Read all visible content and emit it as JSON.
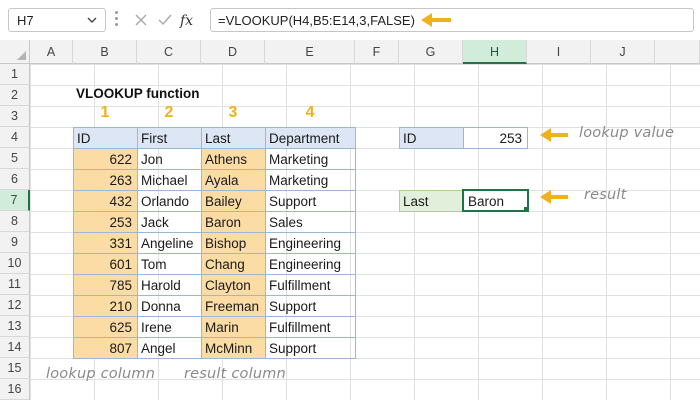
{
  "formula_bar": {
    "name_box": "H7",
    "formula": "=VLOOKUP(H4,B5:E14,3,FALSE)",
    "fx_label": "fx"
  },
  "columns": [
    "A",
    "B",
    "C",
    "D",
    "E",
    "F",
    "G",
    "H",
    "I",
    "J"
  ],
  "rows": [
    "1",
    "2",
    "3",
    "4",
    "5",
    "6",
    "7",
    "8",
    "9",
    "10",
    "11",
    "12",
    "13",
    "14",
    "15",
    "16"
  ],
  "sheet": {
    "title": "VLOOKUP function",
    "col_numbers": [
      "1",
      "2",
      "3",
      "4"
    ],
    "table_headers": [
      "ID",
      "First",
      "Last",
      "Department"
    ],
    "table_rows": [
      {
        "id": "622",
        "first": "Jon",
        "last": "Athens",
        "dept": "Marketing"
      },
      {
        "id": "263",
        "first": "Michael",
        "last": "Ayala",
        "dept": "Marketing"
      },
      {
        "id": "432",
        "first": "Orlando",
        "last": "Bailey",
        "dept": "Support"
      },
      {
        "id": "253",
        "first": "Jack",
        "last": "Baron",
        "dept": "Sales"
      },
      {
        "id": "331",
        "first": "Angeline",
        "last": "Bishop",
        "dept": "Engineering"
      },
      {
        "id": "601",
        "first": "Tom",
        "last": "Chang",
        "dept": "Engineering"
      },
      {
        "id": "785",
        "first": "Harold",
        "last": "Clayton",
        "dept": "Fulfillment"
      },
      {
        "id": "210",
        "first": "Donna",
        "last": "Freeman",
        "dept": "Support"
      },
      {
        "id": "625",
        "first": "Irene",
        "last": "Marin",
        "dept": "Fulfillment"
      },
      {
        "id": "807",
        "first": "Angel",
        "last": "McMinn",
        "dept": "Support"
      }
    ],
    "lookup_label": "ID",
    "lookup_value": "253",
    "result_label": "Last",
    "result_value": "Baron"
  },
  "annotations": {
    "lookup_value": "lookup value",
    "result": "result",
    "lookup_column": "lookup column",
    "result_column": "result column"
  },
  "colors": {
    "accent_arrow": "#f0b21a",
    "highlight_column": "#fbdca4",
    "header_fill": "#dce6f4",
    "selection_green": "#217346"
  }
}
